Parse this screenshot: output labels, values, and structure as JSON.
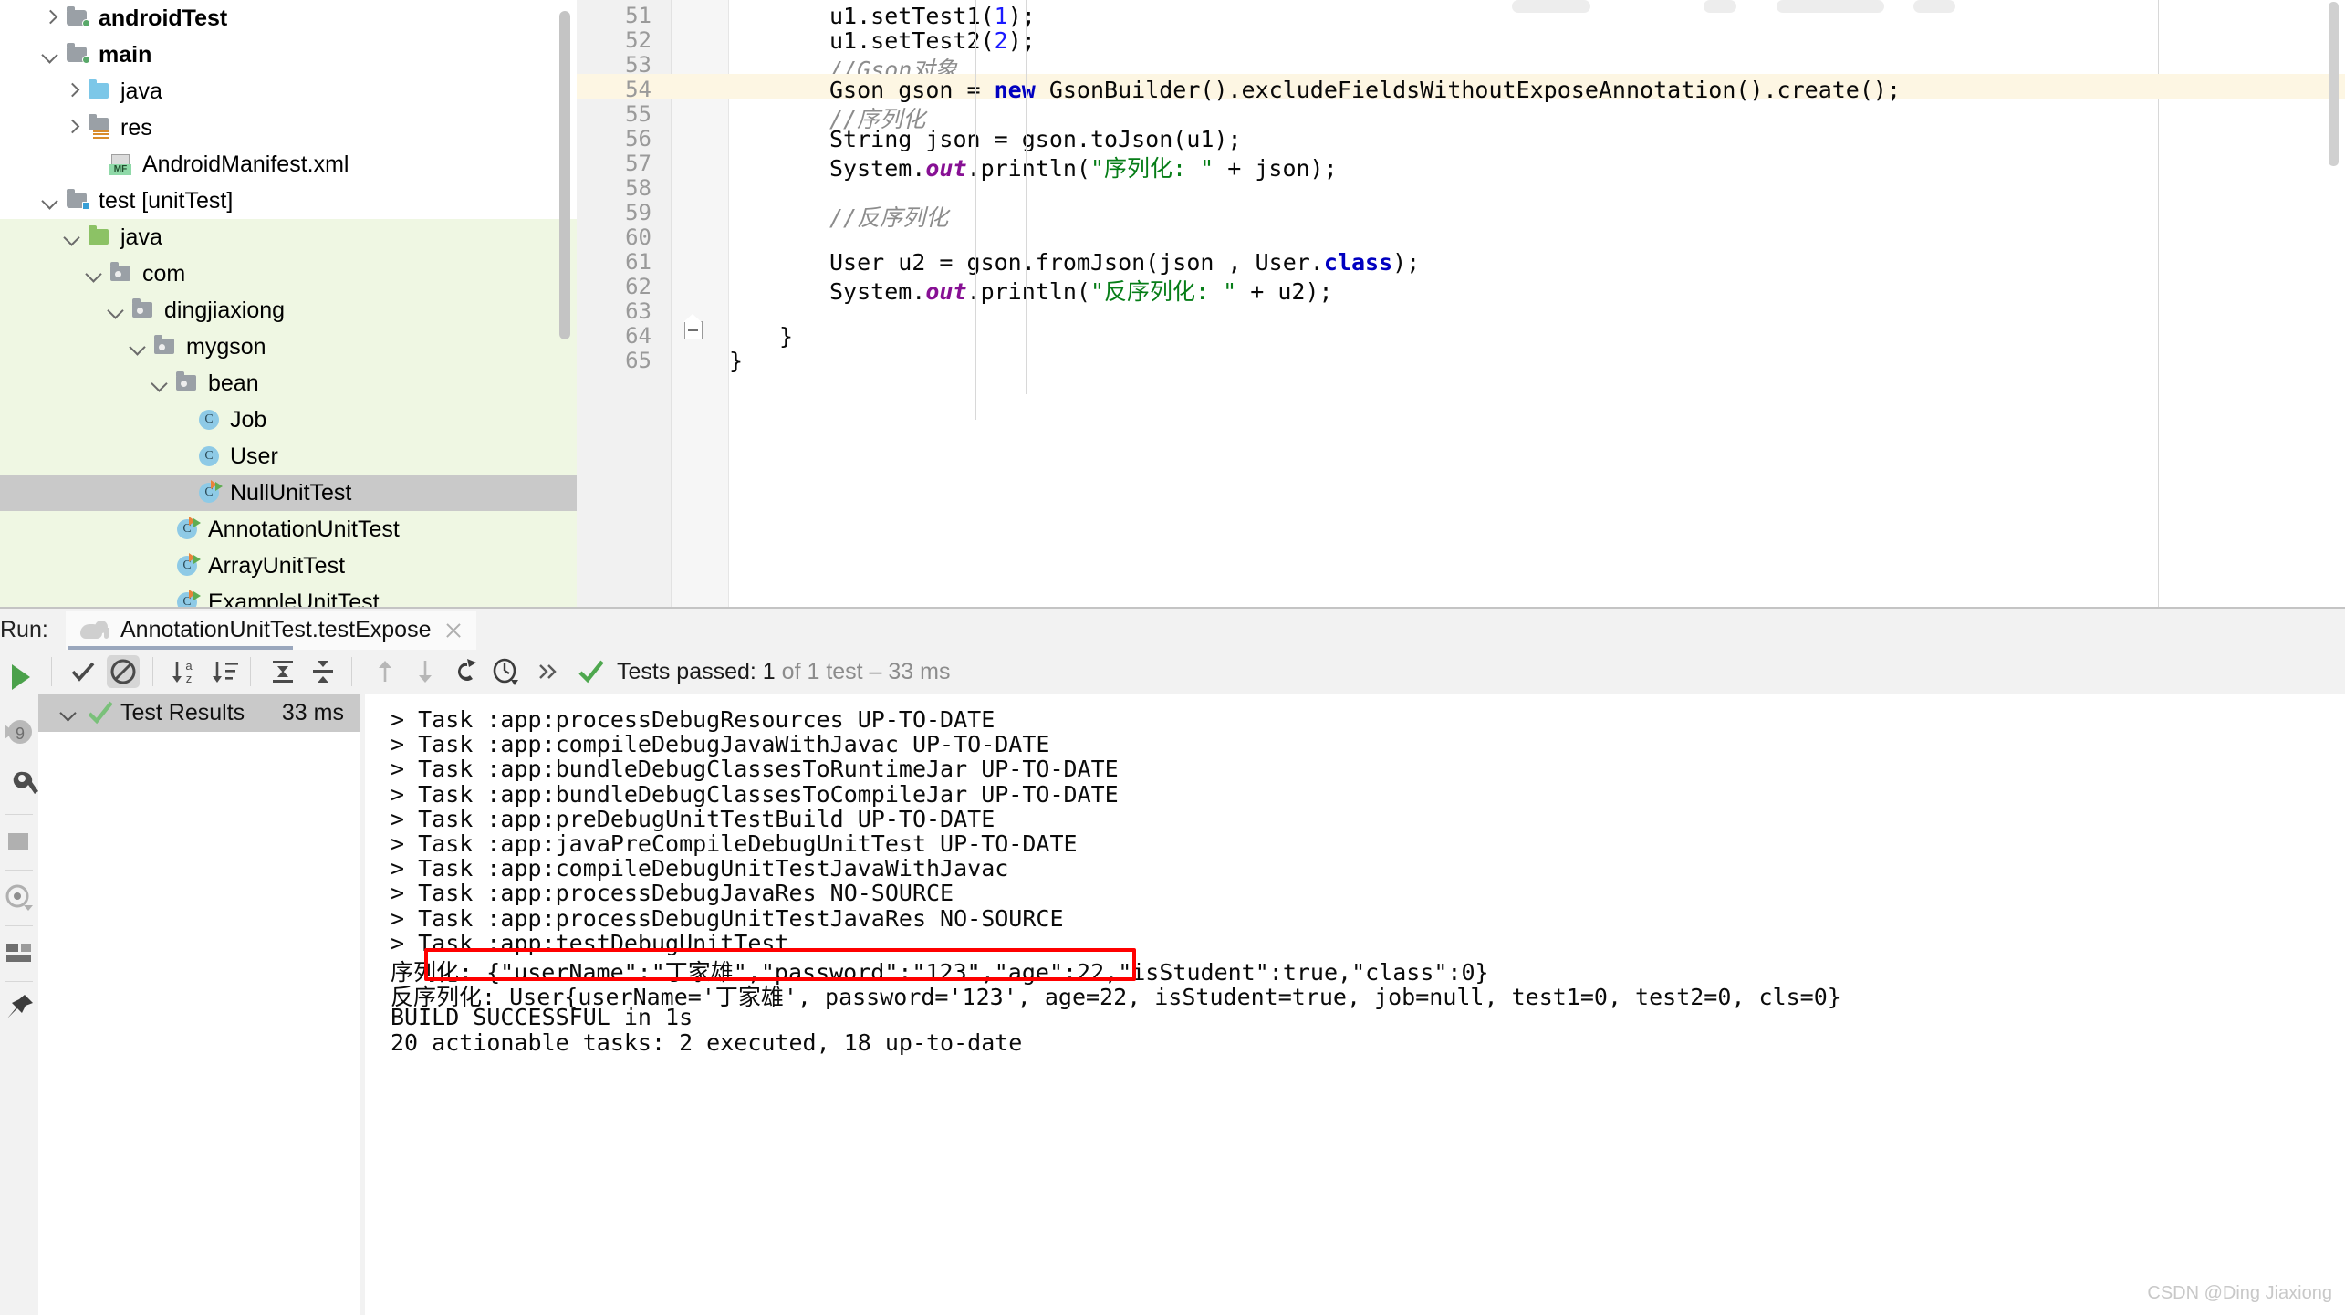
{
  "project_tree": {
    "items": [
      {
        "label": "androidTest",
        "indent": 1,
        "chev": "right",
        "icon": "folder-src-green",
        "bold": true,
        "bg": "white",
        "selected": false
      },
      {
        "label": "main",
        "indent": 1,
        "chev": "down",
        "icon": "folder-src-green",
        "bold": true,
        "bg": "white",
        "selected": false
      },
      {
        "label": "java",
        "indent": 2,
        "chev": "right",
        "icon": "folder-blue",
        "bold": false,
        "bg": "white",
        "selected": false
      },
      {
        "label": "res",
        "indent": 2,
        "chev": "right",
        "icon": "folder-res",
        "bold": false,
        "bg": "white",
        "selected": false
      },
      {
        "label": "AndroidManifest.xml",
        "indent": 3,
        "chev": "none",
        "icon": "manifest",
        "bold": false,
        "bg": "white",
        "selected": false
      },
      {
        "label": "test [unitTest]",
        "indent": 1,
        "chev": "down",
        "icon": "folder-src-blue",
        "bold": false,
        "bg": "white",
        "selected": false
      },
      {
        "label": "java",
        "indent": 2,
        "chev": "down",
        "icon": "folder-green",
        "bold": false,
        "bg": "green",
        "selected": false
      },
      {
        "label": "com",
        "indent": 3,
        "chev": "down",
        "icon": "folder-pkg",
        "bold": false,
        "bg": "green",
        "selected": false
      },
      {
        "label": "dingjiaxiong",
        "indent": 4,
        "chev": "down",
        "icon": "folder-pkg",
        "bold": false,
        "bg": "green",
        "selected": false
      },
      {
        "label": "mygson",
        "indent": 5,
        "chev": "down",
        "icon": "folder-pkg",
        "bold": false,
        "bg": "green",
        "selected": false
      },
      {
        "label": "bean",
        "indent": 6,
        "chev": "down",
        "icon": "folder-pkg",
        "bold": false,
        "bg": "green",
        "selected": false
      },
      {
        "label": "Job",
        "indent": 7,
        "chev": "none",
        "icon": "class",
        "bold": false,
        "bg": "green",
        "selected": false
      },
      {
        "label": "User",
        "indent": 7,
        "chev": "none",
        "icon": "class",
        "bold": false,
        "bg": "green",
        "selected": false
      },
      {
        "label": "NullUnitTest",
        "indent": 7,
        "chev": "none",
        "icon": "class-test",
        "bold": false,
        "bg": "sel",
        "selected": true
      },
      {
        "label": "AnnotationUnitTest",
        "indent": 6,
        "chev": "none",
        "icon": "class-test",
        "bold": false,
        "bg": "green",
        "selected": false
      },
      {
        "label": "ArrayUnitTest",
        "indent": 6,
        "chev": "none",
        "icon": "class-test",
        "bold": false,
        "bg": "green",
        "selected": false
      },
      {
        "label": "ExampleUnitTest",
        "indent": 6,
        "chev": "none",
        "icon": "class-test",
        "bold": false,
        "bg": "green",
        "selected": false
      }
    ]
  },
  "editor": {
    "highlighted_line": 54,
    "lines": [
      {
        "num": "51",
        "tokens": [
          {
            "t": "u1.setTest1(",
            "c": "plain"
          },
          {
            "t": "1",
            "c": "num"
          },
          {
            "t": ");",
            "c": "plain"
          }
        ],
        "indent": 2
      },
      {
        "num": "52",
        "tokens": [
          {
            "t": "u1.setTest2(",
            "c": "plain"
          },
          {
            "t": "2",
            "c": "num"
          },
          {
            "t": ");",
            "c": "plain"
          }
        ],
        "indent": 2
      },
      {
        "num": "53",
        "tokens": [
          {
            "t": "//Gson对象",
            "c": "cmt"
          }
        ],
        "indent": 2
      },
      {
        "num": "54",
        "tokens": [
          {
            "t": "Gson gson = ",
            "c": "plain"
          },
          {
            "t": "new",
            "c": "kw"
          },
          {
            "t": " GsonBuilder().excludeFieldsWithoutExposeAnnotation().create();",
            "c": "plain"
          }
        ],
        "indent": 2
      },
      {
        "num": "55",
        "tokens": [
          {
            "t": "//序列化",
            "c": "cmt"
          }
        ],
        "indent": 2
      },
      {
        "num": "56",
        "tokens": [
          {
            "t": "String json = gson.toJson(u1);",
            "c": "plain"
          }
        ],
        "indent": 2
      },
      {
        "num": "57",
        "tokens": [
          {
            "t": "System.",
            "c": "plain"
          },
          {
            "t": "out",
            "c": "stat"
          },
          {
            "t": ".println(",
            "c": "plain"
          },
          {
            "t": "\"序列化: \"",
            "c": "str"
          },
          {
            "t": " + json);",
            "c": "plain"
          }
        ],
        "indent": 2
      },
      {
        "num": "58",
        "tokens": [],
        "indent": 2
      },
      {
        "num": "59",
        "tokens": [
          {
            "t": "//反序列化",
            "c": "cmt"
          }
        ],
        "indent": 2
      },
      {
        "num": "60",
        "tokens": [],
        "indent": 2
      },
      {
        "num": "61",
        "tokens": [
          {
            "t": "User u2 = gson.fromJson(json , User.",
            "c": "plain"
          },
          {
            "t": "class",
            "c": "kw"
          },
          {
            "t": ");",
            "c": "plain"
          }
        ],
        "indent": 2
      },
      {
        "num": "62",
        "tokens": [
          {
            "t": "System.",
            "c": "plain"
          },
          {
            "t": "out",
            "c": "stat"
          },
          {
            "t": ".println(",
            "c": "plain"
          },
          {
            "t": "\"反序列化: \"",
            "c": "str"
          },
          {
            "t": " + u2);",
            "c": "plain"
          }
        ],
        "indent": 2
      },
      {
        "num": "63",
        "tokens": [],
        "indent": 2
      },
      {
        "num": "64",
        "tokens": [
          {
            "t": "}",
            "c": "plain"
          }
        ],
        "indent": 1
      },
      {
        "num": "65",
        "tokens": [
          {
            "t": "}",
            "c": "plain"
          }
        ],
        "indent": 0
      }
    ]
  },
  "run_panel": {
    "run_label": "Run:",
    "tab_title": "AnnotationUnitTest.testExpose",
    "tab_icon": "gradle-elephant-icon",
    "close_icon": "close-icon",
    "toolbar_icons": [
      "rerun-play-icon",
      "check-show-passed-icon",
      "ignore-tests-icon",
      "sort-alphabetically-icon",
      "sort-by-duration-icon",
      "expand-all-icon",
      "collapse-all-icon",
      "prev-failed-icon",
      "next-failed-icon",
      "gradle-icon",
      "history-clock-icon",
      "more-chevrons-icon"
    ],
    "left_toolbar_icons": [
      "run-play-icon",
      "debug-icon",
      "build-wrench-icon",
      "stop-square-icon",
      "eye-watch-icon",
      "layout-icon",
      "pin-icon"
    ],
    "status": {
      "icon": "green-check-icon",
      "main": "Tests passed: 1",
      "secondary": "of 1 test – 33 ms"
    },
    "test_results": {
      "title": "Test Results",
      "duration": "33 ms",
      "status_icon": "green-check-icon",
      "chevron": "chevron-down-icon"
    }
  },
  "console": {
    "lines": [
      {
        "text": "> Task :app:processDebugResources UP-TO-DATE"
      },
      {
        "text": "> Task :app:compileDebugJavaWithJavac UP-TO-DATE"
      },
      {
        "text": "> Task :app:bundleDebugClassesToRuntimeJar UP-TO-DATE"
      },
      {
        "text": "> Task :app:bundleDebugClassesToCompileJar UP-TO-DATE"
      },
      {
        "text": "> Task :app:preDebugUnitTestBuild UP-TO-DATE"
      },
      {
        "text": "> Task :app:javaPreCompileDebugUnitTest UP-TO-DATE"
      },
      {
        "text": "> Task :app:compileDebugUnitTestJavaWithJavac"
      },
      {
        "text": "> Task :app:processDebugJavaRes NO-SOURCE"
      },
      {
        "text": "> Task :app:processDebugUnitTestJavaRes NO-SOURCE"
      },
      {
        "text": "> Task :app:testDebugUnitTest"
      },
      {
        "text": "序列化: {\"userName\":\"丁家雄\",\"password\":\"123\",\"age\":22,\"isStudent\":true,\"class\":0}"
      },
      {
        "text": "反序列化: User{userName='丁家雄', password='123', age=22, isStudent=true, job=null, test1=0, test2=0, cls=0}"
      },
      {
        "text": "BUILD SUCCESSFUL in 1s"
      },
      {
        "text": "20 actionable tasks: 2 executed, 18 up-to-date"
      }
    ],
    "highlight": {
      "color": "#ff0000",
      "line_index": 10
    }
  },
  "watermark": "CSDN @Ding Jiaxiong",
  "colors": {
    "accent_green": "#59a869",
    "selection_grey": "#c9c9c9",
    "tree_green_bg": "#eff7e3",
    "highlight_line": "#fdf6e3",
    "red_box": "#ff0000"
  }
}
